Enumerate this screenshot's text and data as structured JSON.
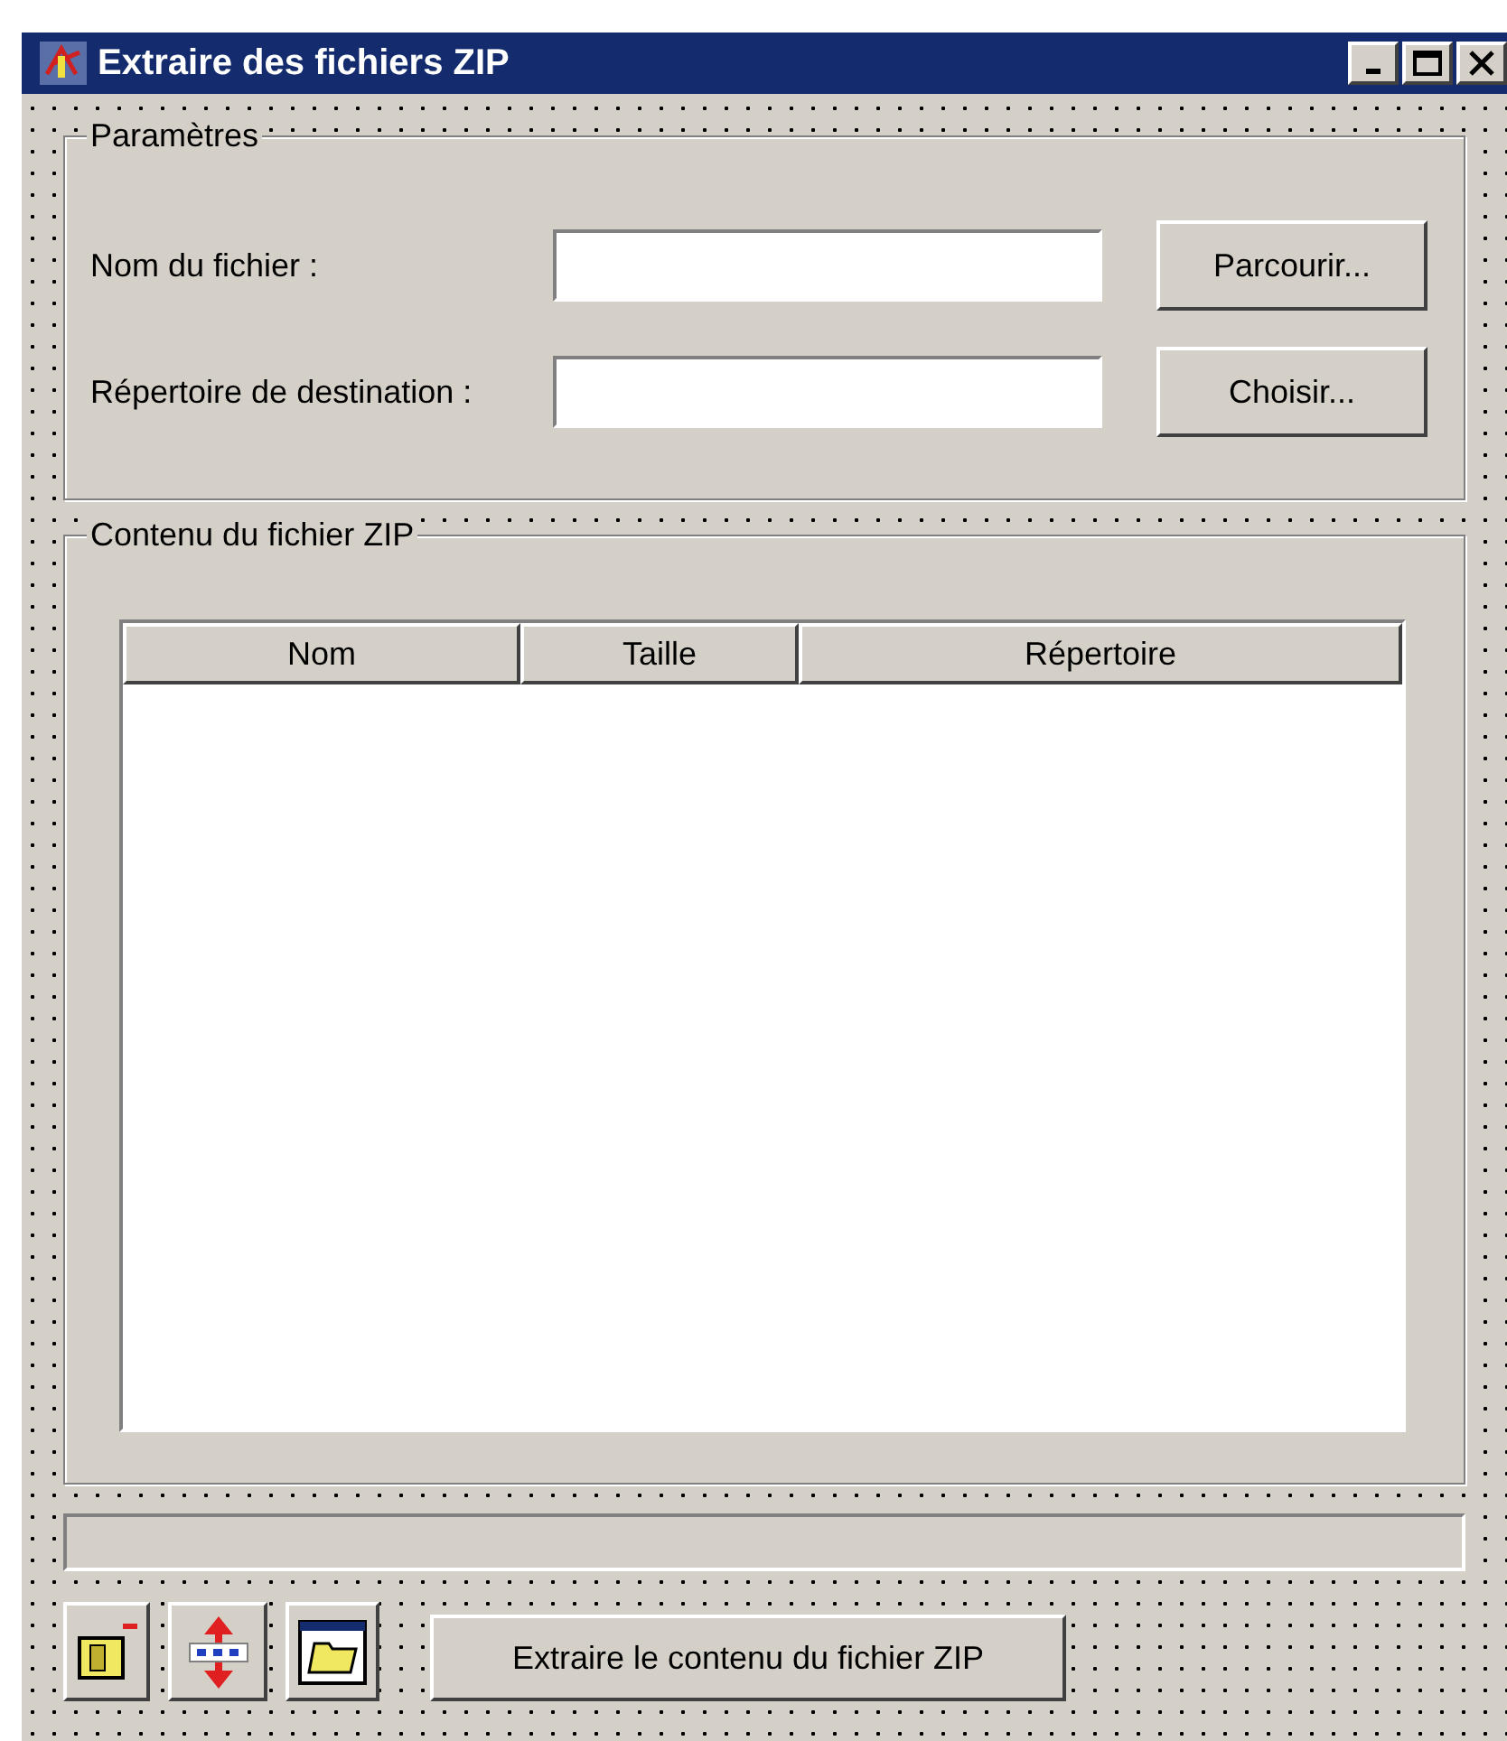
{
  "window": {
    "title": "Extraire des fichiers ZIP"
  },
  "parameters": {
    "title": "Paramètres",
    "fields": [
      {
        "label": "Nom du fichier :",
        "button": "Parcourir..."
      },
      {
        "label": "Répertoire de destination :",
        "button": "Choisir..."
      }
    ]
  },
  "contents": {
    "title": "Contenu du fichier ZIP",
    "columns": [
      "Nom",
      "Taille",
      "Répertoire"
    ]
  },
  "progress": {
    "level": 0
  },
  "toolbar": {
    "extract_button": "Extraire le contenu du fichier ZIP"
  }
}
